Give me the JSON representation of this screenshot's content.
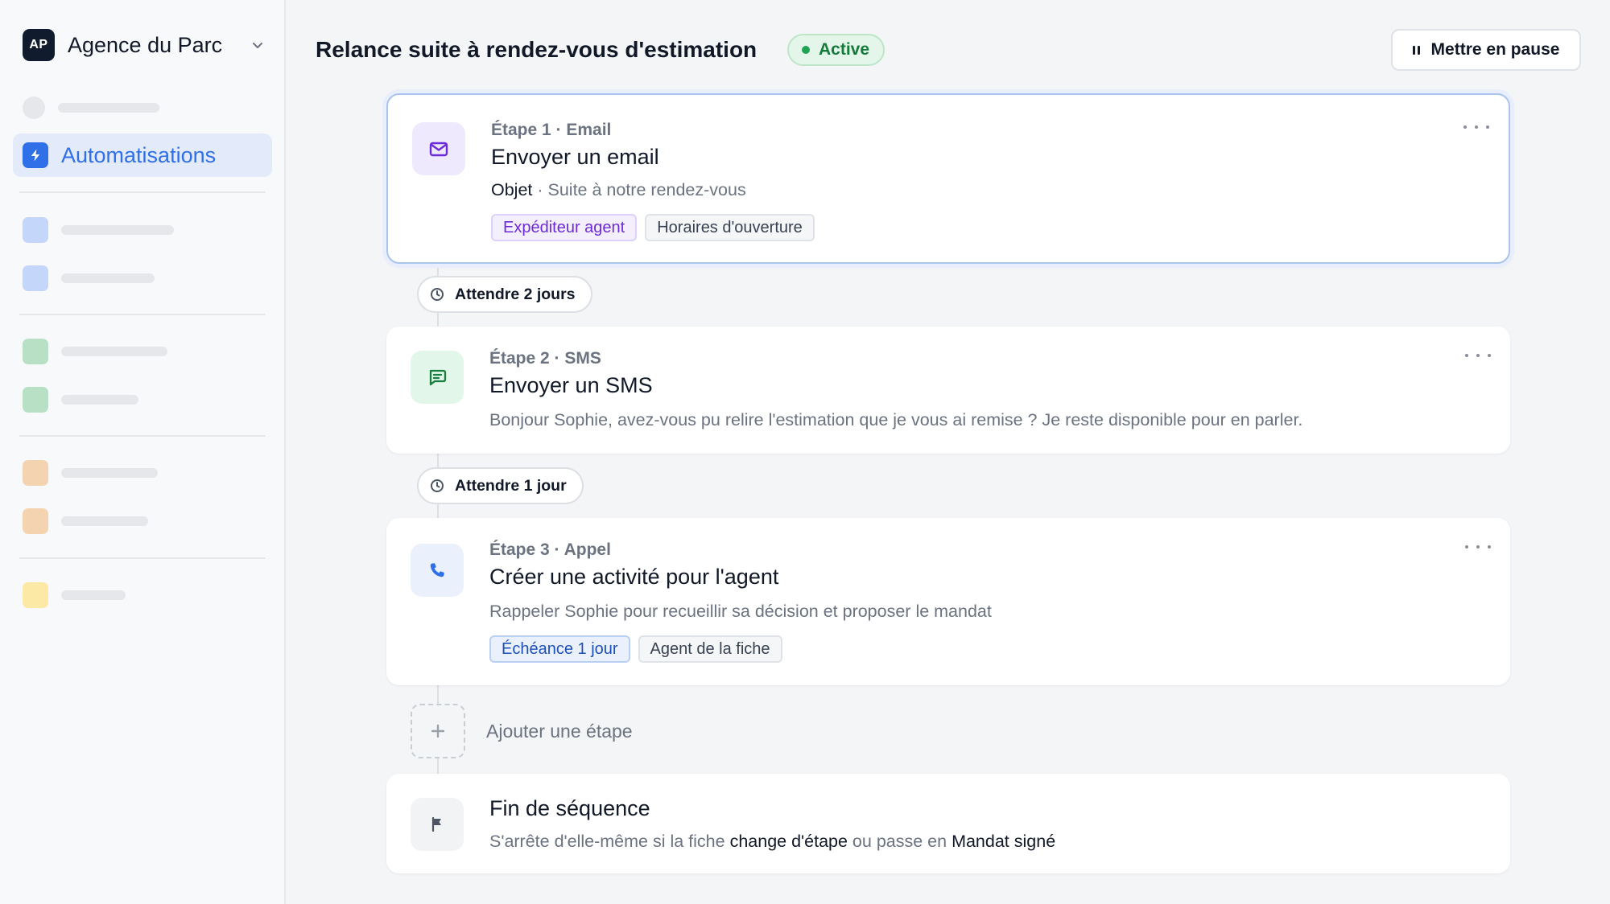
{
  "sidebar": {
    "workspace": {
      "initials": "AP",
      "name": "Agence du Parc",
      "chevron_icon": "chevron-down-icon"
    },
    "active_item": {
      "label": "Automatisations",
      "icon": "lightning-icon"
    },
    "placeholder_colors": [
      "#c5d6fb",
      "#b8e0c4",
      "#f4d3b0",
      "#fde9a6"
    ]
  },
  "header": {
    "title": "Relance suite à rendez-vous d'estimation",
    "status": "Active",
    "pause_label": "Mettre en pause"
  },
  "steps": [
    {
      "meta": "Étape 1 · Email",
      "title": "Envoyer un email",
      "subject_label": "Objet",
      "subject_value": " · Suite à notre rendez-vous",
      "icon": "mail-icon",
      "tags": [
        "Expéditeur agent",
        "Horaires d'ouverture"
      ]
    },
    {
      "meta": "Étape 2 · SMS",
      "title": "Envoyer un SMS",
      "description": "Bonjour Sophie, avez-vous pu relire l'estimation que je vous ai remise ? Je reste disponible pour en parler.",
      "icon": "message-icon"
    },
    {
      "meta": "Étape 3 · Appel",
      "title": "Créer une activité pour l'agent",
      "description": "Rappeler Sophie pour recueillir sa décision et proposer le mandat",
      "icon": "phone-icon",
      "tags": [
        "Échéance 1 jour",
        "Agent de la fiche"
      ]
    }
  ],
  "waits": [
    "Attendre 2 jours",
    "Attendre 1 jour"
  ],
  "add_step_label": "Ajouter une étape",
  "end": {
    "title": "Fin de séquence",
    "text_1": "S'arrête d'elle-même si la fiche ",
    "strong_1": "change d'étape",
    "text_2": " ou passe en ",
    "strong_2": "Mandat signé",
    "icon": "flag-icon"
  },
  "colors": {
    "accent": "#2f6fe8",
    "status_green": "#1ea453",
    "tag_purple": "#6c2bd9"
  }
}
